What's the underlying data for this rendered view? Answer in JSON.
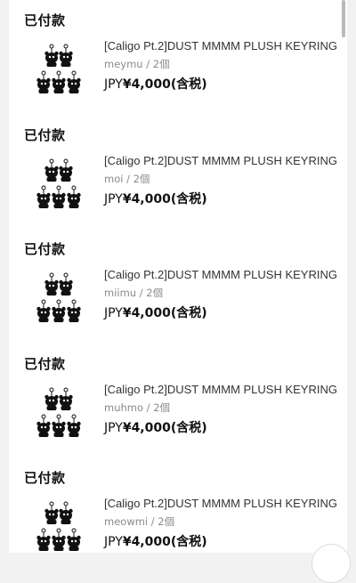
{
  "orders": [
    {
      "status": "已付款",
      "title": "[Caligo Pt.2]DUST MMMM PLUSH KEYRING",
      "meta": "meymu / 2個",
      "currency": "JPY",
      "amount": "¥4,000(含税)"
    },
    {
      "status": "已付款",
      "title": "[Caligo Pt.2]DUST MMMM PLUSH KEYRING",
      "meta": "moi / 2個",
      "currency": "JPY",
      "amount": "¥4,000(含税)"
    },
    {
      "status": "已付款",
      "title": "[Caligo Pt.2]DUST MMMM PLUSH KEYRING",
      "meta": "miimu / 2個",
      "currency": "JPY",
      "amount": "¥4,000(含税)"
    },
    {
      "status": "已付款",
      "title": "[Caligo Pt.2]DUST MMMM PLUSH KEYRING",
      "meta": "muhmo / 2個",
      "currency": "JPY",
      "amount": "¥4,000(含税)"
    },
    {
      "status": "已付款",
      "title": "[Caligo Pt.2]DUST MMMM PLUSH KEYRING",
      "meta": "meowmi / 2個",
      "currency": "JPY",
      "amount": "¥4,000(含税)"
    }
  ],
  "colors": {
    "background": "#f2f2f2",
    "card": "#ffffff",
    "text": "#111111",
    "muted": "#8a8a8a"
  },
  "icons": {
    "product": "plush-keyring-thumbnail",
    "scroll_to_top": "scroll-to-top-button"
  }
}
